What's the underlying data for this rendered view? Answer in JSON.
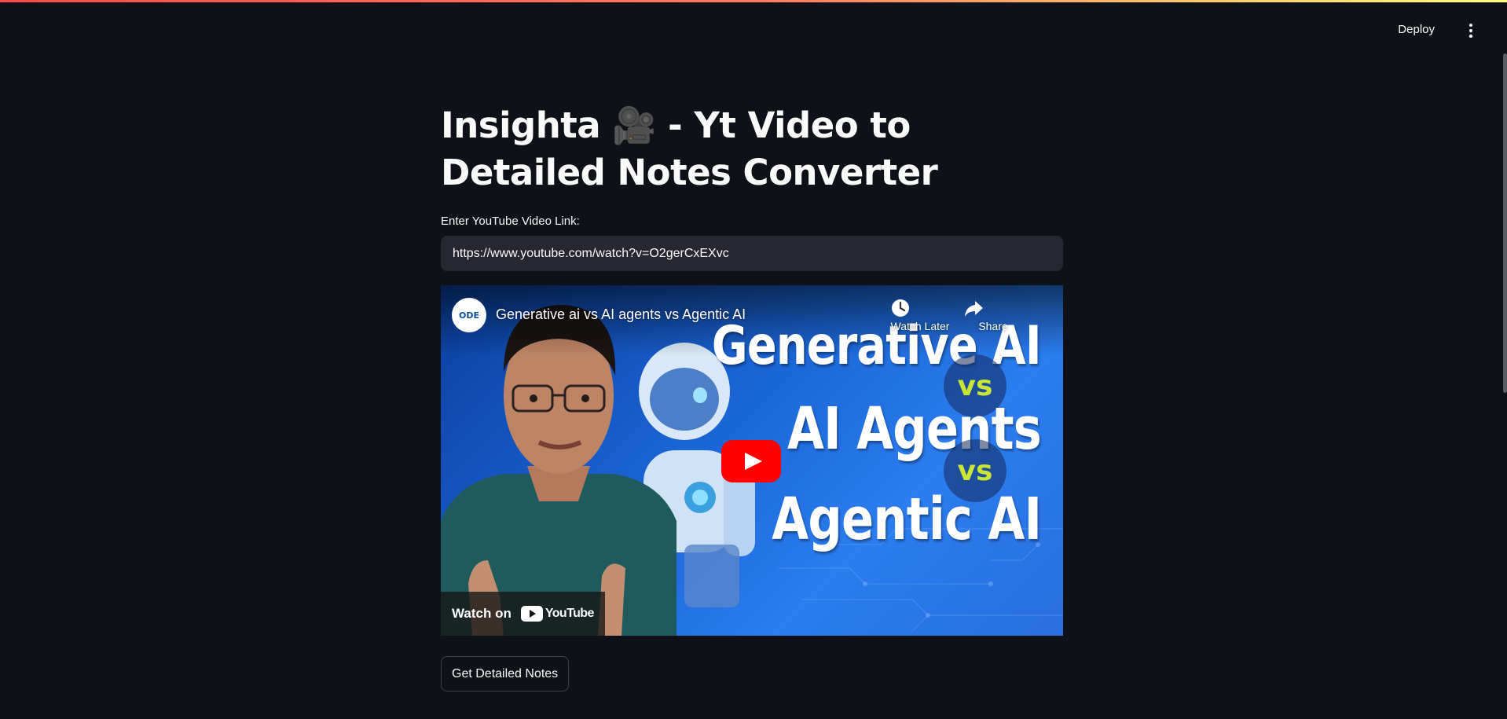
{
  "header": {
    "deploy_label": "Deploy",
    "menu_icon": "kebab-menu-icon"
  },
  "page": {
    "title": "Insighta 🎥 - Yt Video to Detailed Notes Converter"
  },
  "form": {
    "link_label": "Enter YouTube Video Link:",
    "link_value": "https://www.youtube.com/watch?v=O2gerCxEXvc"
  },
  "video": {
    "channel_logo_text": "ODE",
    "title": "Generative ai vs AI agents vs Agentic AI",
    "watch_later_label": "Watch Later",
    "share_label": "Share",
    "thumb_line1": "Generative AI",
    "thumb_vs1": "vs",
    "thumb_line2": "AI Agents",
    "thumb_vs2": "vs",
    "thumb_line3": "Agentic AI",
    "watch_on_label": "Watch on",
    "youtube_word": "YouTube"
  },
  "actions": {
    "submit_label": "Get Detailed Notes"
  },
  "colors": {
    "background": "#0e1117",
    "input_bg": "#262730",
    "youtube_red": "#ff0000",
    "vs_accent": "#c9e634"
  }
}
